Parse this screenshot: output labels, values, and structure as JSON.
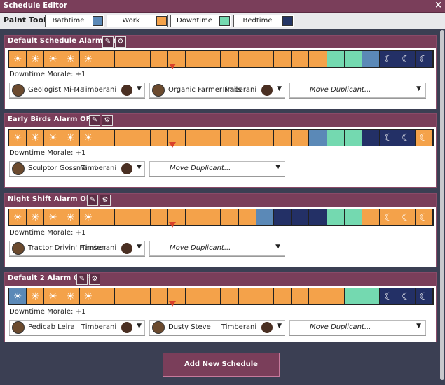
{
  "window": {
    "title": "Schedule Editor",
    "close_glyph": "×"
  },
  "toolbar": {
    "label": "Paint Tools:",
    "tools": [
      {
        "name": "Bathtime",
        "color": "#5b89b7"
      },
      {
        "name": "Work",
        "color": "#f4a24a"
      },
      {
        "name": "Downtime",
        "color": "#74d9b0"
      },
      {
        "name": "Bedtime",
        "color": "#243565"
      }
    ]
  },
  "colors": {
    "work": "#f4a24a",
    "bath": "#5b89b7",
    "down": "#74d9b0",
    "bed": "#243565",
    "bedtime_blocks": "#233066"
  },
  "icons": {
    "edit": "✎",
    "settings": "⚙",
    "sun": "☀",
    "moon": "☾",
    "dropdown": "▼"
  },
  "schedules": [
    {
      "name": "Default Schedule",
      "alarm": "Alarm On",
      "morale": "Downtime Morale: +1",
      "blocks": [
        "w",
        "w",
        "w",
        "w",
        "w",
        "w",
        "w",
        "w",
        "w",
        "w",
        "w",
        "w",
        "w",
        "w",
        "w",
        "w",
        "w",
        "w",
        "d",
        "d",
        "b",
        "n",
        "n",
        "n"
      ],
      "night_icons": [
        21,
        22,
        23
      ],
      "sun_icons": [
        0,
        1,
        2,
        3,
        4
      ],
      "dupes": [
        {
          "name": "Geologist Mi-Ma",
          "group": "Timberani"
        },
        {
          "name": "Organic Farmer Nails",
          "group": "Timberani"
        }
      ],
      "move_placeholder": "Move Duplicant..."
    },
    {
      "name": "Early Birds",
      "alarm": "Alarm OFF",
      "morale": "Downtime Morale: +1",
      "blocks": [
        "w",
        "w",
        "w",
        "w",
        "w",
        "w",
        "w",
        "w",
        "w",
        "w",
        "w",
        "w",
        "w",
        "w",
        "w",
        "w",
        "w",
        "b",
        "d",
        "d",
        "n",
        "n",
        "n",
        "w"
      ],
      "night_icons": [
        21,
        22,
        23
      ],
      "sun_icons": [
        0,
        1,
        2,
        3,
        4
      ],
      "dupes": [
        {
          "name": "Sculptor Gossmann",
          "group": "Timberani"
        }
      ],
      "move_placeholder": "Move Duplicant..."
    },
    {
      "name": "Night Shift",
      "alarm": "Alarm OFF",
      "morale": "Downtime Morale: +1",
      "blocks": [
        "w",
        "w",
        "w",
        "w",
        "w",
        "w",
        "w",
        "w",
        "w",
        "w",
        "w",
        "w",
        "w",
        "w",
        "b",
        "n",
        "n",
        "n",
        "d",
        "d",
        "w",
        "w",
        "w",
        "w"
      ],
      "night_icons": [
        21,
        22,
        23
      ],
      "sun_icons": [
        0,
        1,
        2,
        3,
        4
      ],
      "dupes": [
        {
          "name": "Tractor Drivin' Hansen",
          "group": "Timberani"
        }
      ],
      "move_placeholder": "Move Duplicant..."
    },
    {
      "name": "Default 2",
      "alarm": "Alarm OFF",
      "morale": "Downtime Morale: +1",
      "blocks": [
        "b",
        "w",
        "w",
        "w",
        "w",
        "w",
        "w",
        "w",
        "w",
        "w",
        "w",
        "w",
        "w",
        "w",
        "w",
        "w",
        "w",
        "w",
        "w",
        "d",
        "d",
        "n",
        "n",
        "n"
      ],
      "night_icons": [
        21,
        22,
        23
      ],
      "sun_icons": [
        0,
        1,
        2,
        3,
        4
      ],
      "dupes": [
        {
          "name": "Pedicab Leira",
          "group": "Timberani"
        },
        {
          "name": "Dusty Steve",
          "group": "Timberani"
        }
      ],
      "move_placeholder": "Move Duplicant..."
    }
  ],
  "add_button": "Add New Schedule"
}
